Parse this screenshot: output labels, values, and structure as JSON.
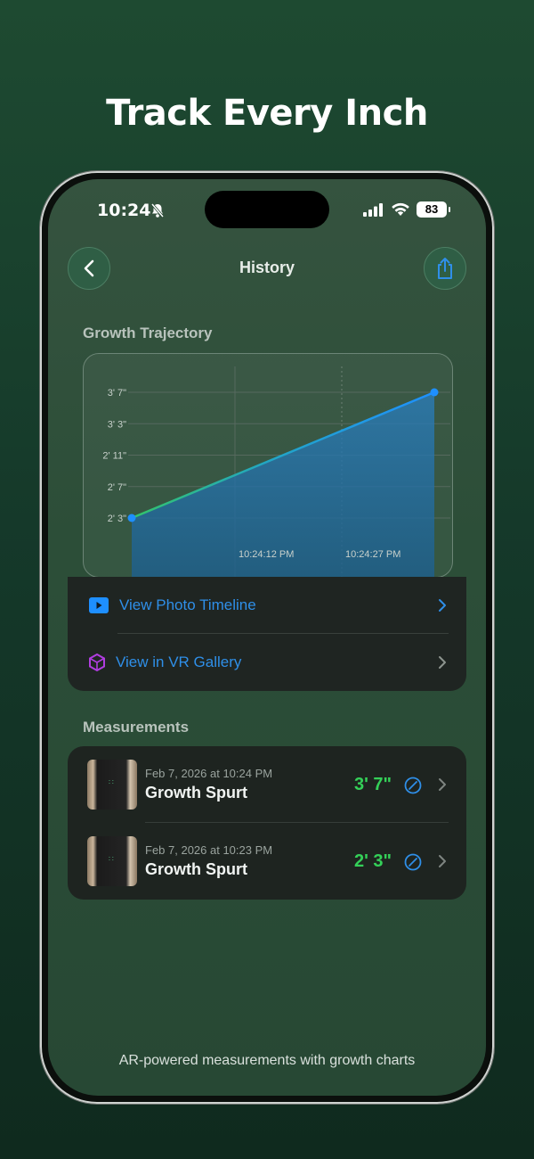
{
  "headline": "Track Every Inch",
  "status_bar": {
    "time": "10:24",
    "battery": "83"
  },
  "nav": {
    "title": "History"
  },
  "growth": {
    "section_title": "Growth Trajectory"
  },
  "chart_data": {
    "type": "area",
    "title": "",
    "xlabel": "",
    "ylabel": "",
    "y_tick_labels": [
      "3' 7\"",
      "3' 3\"",
      "2' 11\"",
      "2' 7\"",
      "2' 3\""
    ],
    "y_ticks_inches": [
      43,
      39,
      35,
      31,
      27
    ],
    "x_tick_labels": [
      "10:24:12 PM",
      "10:24:27 PM"
    ],
    "series": [
      {
        "x": [
          "10:23 PM",
          "10:24 PM"
        ],
        "y_inches": [
          27,
          43
        ]
      }
    ],
    "ylim_inches": [
      27,
      43
    ],
    "grid": true,
    "colors": {
      "line_start": "#34c46a",
      "line_end": "#1e90ff",
      "fill": "#1f5f8a",
      "point": "#1e8fff"
    }
  },
  "links": [
    {
      "label": "View Photo Timeline",
      "icon": "play-icon",
      "color": "#2f8fe8"
    },
    {
      "label": "View in VR Gallery",
      "icon": "vr-cube-icon",
      "color": "#2f8fe8"
    }
  ],
  "measurements": {
    "section_title": "Measurements",
    "items": [
      {
        "date": "Feb 7, 2026 at 10:24 PM",
        "title": "Growth Spurt",
        "value": "3' 7\""
      },
      {
        "date": "Feb 7, 2026 at 10:23 PM",
        "title": "Growth Spurt",
        "value": "2' 3\""
      }
    ]
  },
  "footer": "AR-powered measurements with growth charts"
}
